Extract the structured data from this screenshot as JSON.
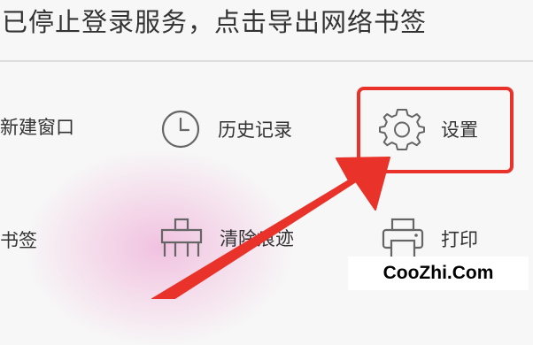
{
  "banner": {
    "text": "已停止登录服务，点击导出网络书签"
  },
  "menu": {
    "new_window": {
      "label": "新建窗口"
    },
    "history": {
      "label": "历史记录",
      "icon": "clock-icon"
    },
    "settings": {
      "label": "设置",
      "icon": "gear-icon"
    },
    "bookmarks": {
      "label": "书签"
    },
    "clear_traces": {
      "label": "清除痕迹",
      "icon": "broom-icon"
    },
    "print": {
      "label": "打印",
      "icon": "printer-icon"
    }
  },
  "annotation": {
    "highlight_color": "#e8322a",
    "arrow_color": "#e8322a"
  },
  "watermark": {
    "text": "CooZhi.Com"
  }
}
